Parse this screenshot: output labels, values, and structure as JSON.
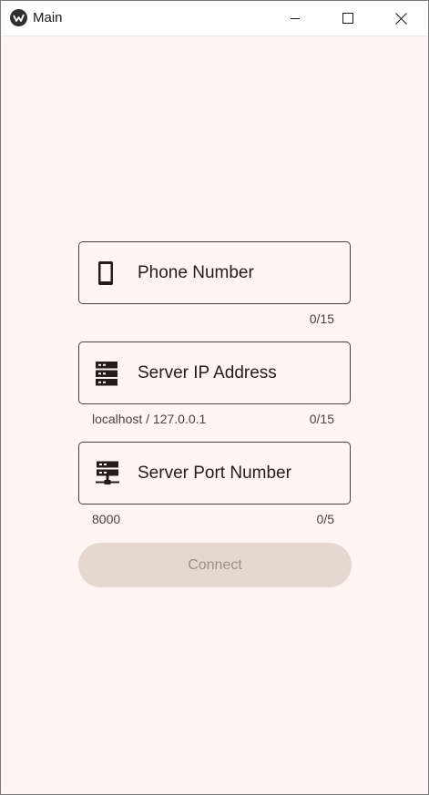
{
  "window": {
    "title": "Main",
    "controls": {
      "minimize": "minimize-icon",
      "maximize": "maximize-icon",
      "close": "close-icon"
    }
  },
  "form": {
    "phone": {
      "label": "Phone Number",
      "icon": "cellphone-icon",
      "helper": "",
      "counter": "0/15"
    },
    "server_ip": {
      "label": "Server IP Address",
      "icon": "server-icon",
      "helper": "localhost / 127.0.0.1",
      "counter": "0/15"
    },
    "server_port": {
      "label": "Server Port Number",
      "icon": "server-network-icon",
      "helper": "8000",
      "counter": "0/5"
    },
    "connect": {
      "label": "Connect",
      "disabled": true
    }
  },
  "colors": {
    "background": "#fff6f3",
    "field_border": "#4a403c",
    "button_disabled_bg": "#e4d8cf",
    "button_disabled_text": "#9b918b"
  }
}
